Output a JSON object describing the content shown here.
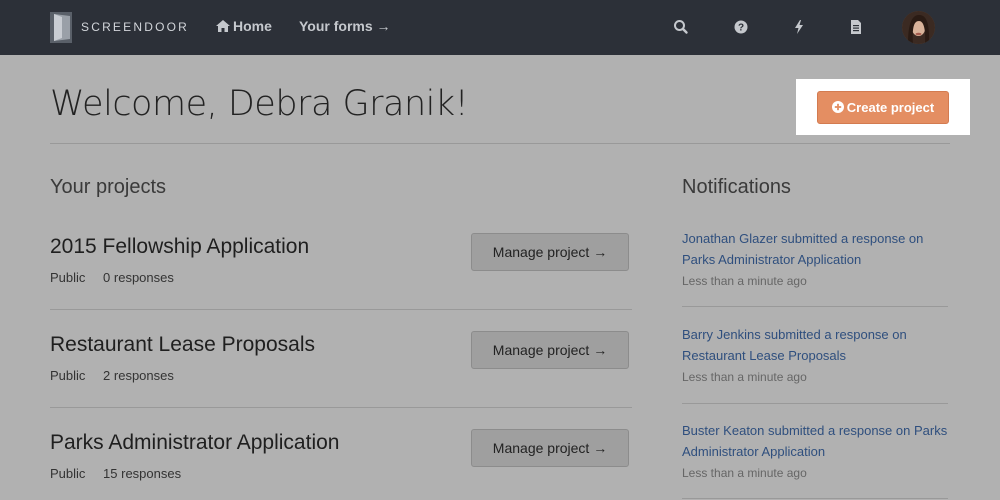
{
  "header": {
    "brand": "SCREENDOOR",
    "nav": [
      {
        "icon": "home-icon",
        "label": "Home"
      },
      {
        "label": "Your forms →"
      }
    ],
    "icons": [
      "search-icon",
      "help-icon",
      "lightning-icon",
      "document-icon"
    ]
  },
  "main": {
    "welcome": "Welcome, Debra Granik!",
    "create_button": "Create project",
    "projects_title": "Your projects",
    "notifications_title": "Notifications"
  },
  "projects": [
    {
      "name": "2015 Fellowship Application",
      "visibility": "Public",
      "responses": "0 responses",
      "button": "Manage project →"
    },
    {
      "name": "Restaurant Lease Proposals",
      "visibility": "Public",
      "responses": "2 responses",
      "button": "Manage project →"
    },
    {
      "name": "Parks Administrator Application",
      "visibility": "Public",
      "responses": "15 responses",
      "button": "Manage project →"
    }
  ],
  "notifications": [
    {
      "text": "Jonathan Glazer submitted a response on Parks Administrator Application",
      "time": "Less than a minute ago"
    },
    {
      "text": "Barry Jenkins submitted a response on Restaurant Lease Proposals",
      "time": "Less than a minute ago"
    },
    {
      "text": "Buster Keaton submitted a response on Parks Administrator Application",
      "time": "Less than a minute ago"
    }
  ],
  "colors": {
    "topbar": "#2c3038",
    "accent": "#e48e62",
    "link": "#2f4f7e",
    "background": "#b1b1b1"
  }
}
